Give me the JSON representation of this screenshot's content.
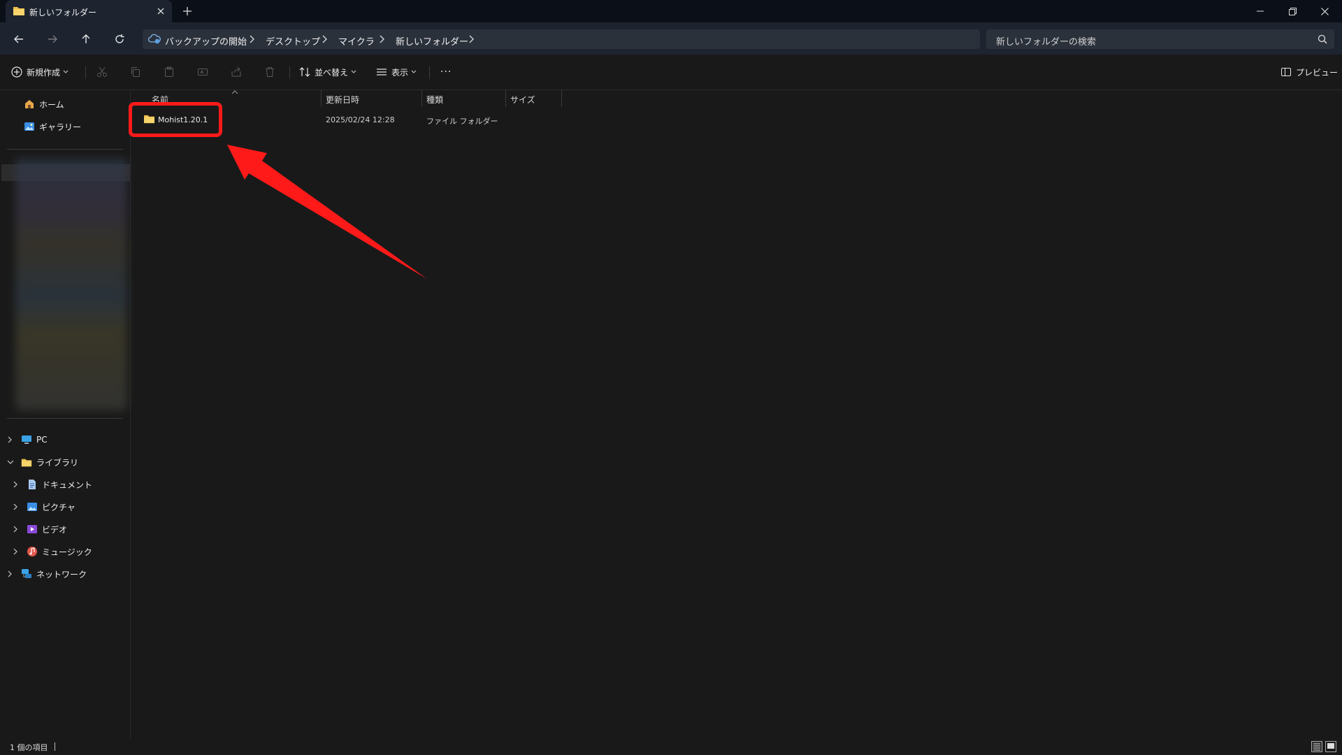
{
  "window": {
    "tab_title": "新しいフォルダー",
    "tab_icon": "folder-icon",
    "new_tab_icon": "plus-icon",
    "controls": [
      "minimize-icon",
      "restore-icon",
      "close-icon"
    ]
  },
  "navigation": {
    "buttons": [
      "back-arrow-icon",
      "forward-arrow-icon",
      "up-arrow-icon",
      "refresh-icon"
    ],
    "breadcrumbs": [
      "バックアップの開始",
      "デスクトップ",
      "マイクラ",
      "新しいフォルダー"
    ],
    "search_placeholder": "新しいフォルダーの検索"
  },
  "toolbar": {
    "new_label": "新規作成",
    "sort_label": "並べ替え",
    "view_label": "表示",
    "more_label": "···",
    "preview_label": "プレビュー",
    "disabled_icons": [
      "cut-icon",
      "copy-icon",
      "paste-icon",
      "rename-icon",
      "share-icon",
      "delete-icon"
    ]
  },
  "sidebar": {
    "quick": [
      {
        "label": "ホーム",
        "icon": "home-icon"
      },
      {
        "label": "ギャラリー",
        "icon": "gallery-icon"
      }
    ],
    "tree": [
      {
        "label": "PC",
        "icon": "pc-icon",
        "expanded": false
      },
      {
        "label": "ライブラリ",
        "icon": "library-folder-icon",
        "expanded": true
      },
      {
        "label": "ドキュメント",
        "icon": "documents-icon",
        "expanded": false
      },
      {
        "label": "ピクチャ",
        "icon": "pictures-icon",
        "expanded": false
      },
      {
        "label": "ビデオ",
        "icon": "videos-icon",
        "expanded": false
      },
      {
        "label": "ミュージック",
        "icon": "music-icon",
        "expanded": false
      },
      {
        "label": "ネットワーク",
        "icon": "network-icon",
        "expanded": false
      }
    ]
  },
  "file_list": {
    "columns": [
      "名前",
      "更新日時",
      "種類",
      "サイズ"
    ],
    "rows": [
      {
        "name": "Mohist1.20.1",
        "modified": "2025/02/24 12:28",
        "type": "ファイル フォルダー",
        "size": ""
      }
    ]
  },
  "status": {
    "item_count": "1 個の項目"
  },
  "colors": {
    "accent_folder": "#f2c14e",
    "annotation": "#ff1a1a"
  }
}
